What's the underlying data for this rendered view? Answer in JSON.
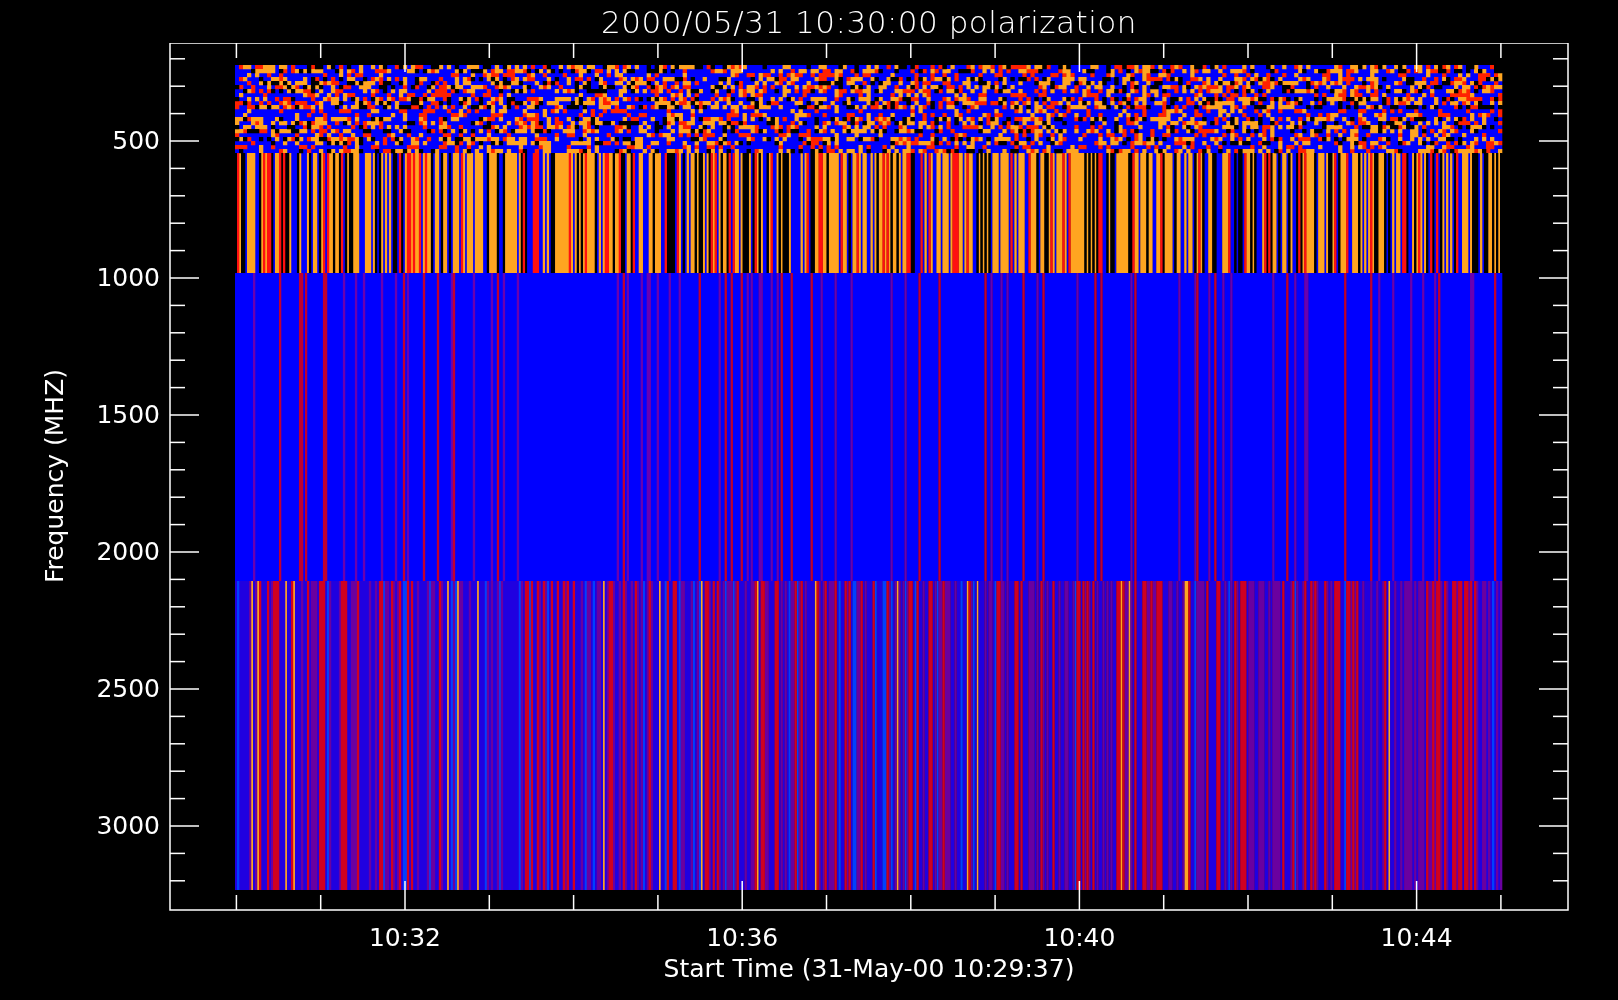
{
  "title": "2000/05/31 10:30:00 polarization",
  "plot": {
    "ylabel": "Frequency (MHZ)",
    "xlabel": "Start Time (31-May-00 10:29:37)",
    "yticks": [
      "500",
      "1000",
      "1500",
      "2000",
      "2500",
      "3000"
    ],
    "xticks": [
      "10:32",
      "10:36",
      "10:40",
      "10:44"
    ]
  }
}
